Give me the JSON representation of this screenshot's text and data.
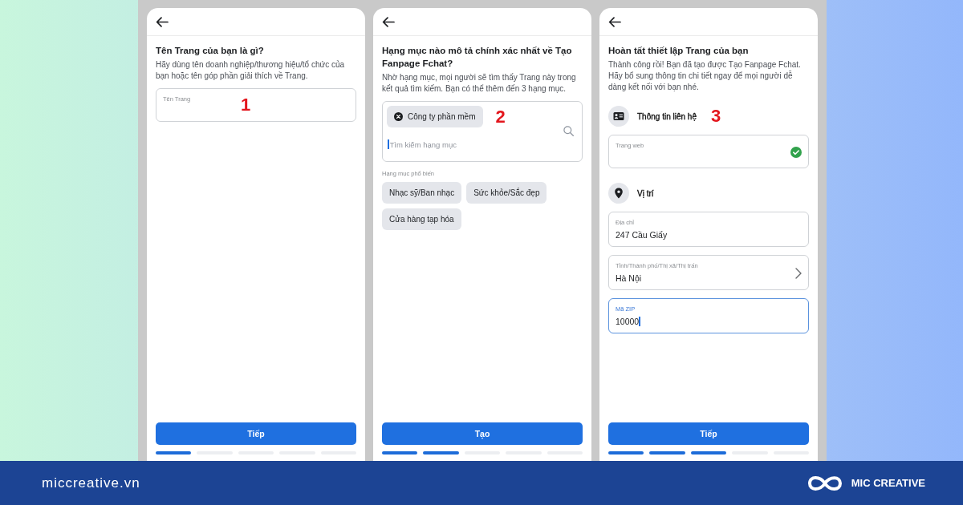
{
  "screens": [
    {
      "title": "Tên Trang của bạn là gì?",
      "description": "Hãy dùng tên doanh nghiệp/thương hiệu/tổ chức của bạn hoặc tên góp phần giải thích về Trang.",
      "content": [
        {
          "kind": "field",
          "label": "Tên Trang",
          "focused": false,
          "valid": false,
          "annotation": "1"
        }
      ],
      "button": "Tiếp",
      "steps": [
        {
          "complete": true
        },
        {
          "complete": false
        },
        {
          "complete": false
        },
        {
          "complete": false
        },
        {
          "complete": false
        }
      ]
    },
    {
      "title": "Hạng mục nào mô tả chính xác nhất về Tạo Fanpage Fchat?",
      "description": "Nhờ hạng mục, mọi người sẽ tìm thấy Trang này trong kết quả tìm kiếm. Bạn có thể thêm đến 3 hạng mục.",
      "content": [
        {
          "kind": "category_box",
          "chips": [
            "Công ty phần mềm"
          ],
          "placeholder": "Tìm kiếm hạng mục",
          "focused": true,
          "annotation": "2"
        },
        {
          "kind": "hint",
          "text": "Hạng mục phổ biến"
        },
        {
          "kind": "chips",
          "items": [
            "Nhạc sỹ/Ban nhạc",
            "Sức khỏe/Sắc đẹp",
            "Cửa hàng tạp hóa"
          ]
        }
      ],
      "button": "Tạo",
      "steps": [
        {
          "complete": true
        },
        {
          "complete": true
        },
        {
          "complete": false
        },
        {
          "complete": false
        },
        {
          "complete": false
        }
      ]
    },
    {
      "title": "Hoàn tất thiết lập Trang của bạn",
      "description": "Thành công rồi! Bạn đã tạo được Tạo Fanpage Fchat. Hãy bổ sung thông tin chi tiết ngay để mọi người dễ dàng kết nối với bạn nhé.",
      "content": [
        {
          "kind": "section",
          "label": "Thông tin liên hệ",
          "annotation": "3"
        },
        {
          "kind": "field",
          "label": "Trang web",
          "focused": false,
          "valid": true
        },
        {
          "kind": "section",
          "label": "Vị trí"
        },
        {
          "kind": "field",
          "label": "Địa chỉ",
          "value": "247 Cầu Giấy",
          "focused": false,
          "valid": false
        },
        {
          "kind": "select",
          "label": "Tỉnh/Thành phố/Thị xã/Thị trấn",
          "value": "Hà Nội",
          "focused": false,
          "valid": false
        },
        {
          "kind": "field",
          "label": "Mã ZIP",
          "value": "10000",
          "focused": true,
          "valid": false
        }
      ],
      "button": "Tiếp",
      "steps": [
        {
          "complete": true
        },
        {
          "complete": true
        },
        {
          "complete": true
        },
        {
          "complete": false
        },
        {
          "complete": false
        }
      ]
    }
  ],
  "footer": {
    "website": "miccreative.vn",
    "brand": "MIC CREATIVE"
  }
}
